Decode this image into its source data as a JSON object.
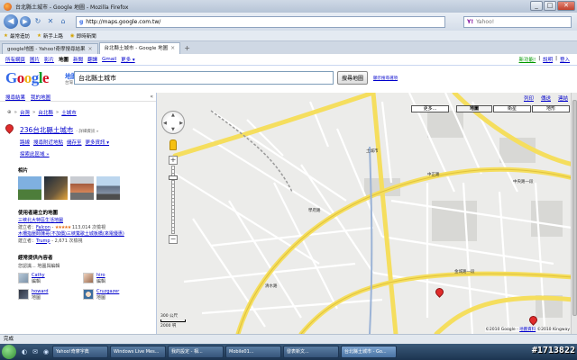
{
  "window": {
    "title": "台北縣土城市 - Google 地圖 - Mozilla Firefox",
    "min": "_",
    "max": "□",
    "close": "✕"
  },
  "nav": {
    "url": "http://maps.google.com.tw/",
    "search_placeholder": "Yahoo!",
    "search_brand": "Y!"
  },
  "bookmarks": [
    "最常造訪",
    "新手上路",
    "即時新聞"
  ],
  "tabs": [
    {
      "label": "google地圖 - Yahoo!奇摩搜尋結果",
      "active": false
    },
    {
      "label": "台北縣土城市 - Google 地圖",
      "active": true
    }
  ],
  "gnav": {
    "links": [
      "所有網頁",
      "圖片",
      "影片",
      "地圖",
      "新聞",
      "翻譯",
      "Gmail",
      "更多 ▾"
    ],
    "current": "地圖",
    "right": [
      "新功能!",
      "說明",
      "登入"
    ],
    "right_sep": "|"
  },
  "header": {
    "logo": {
      "G": "G",
      "o1": "o",
      "o2": "o",
      "g": "g",
      "l": "l",
      "e": "e"
    },
    "logo_sub": "地圖",
    "logo_sub2": "台灣",
    "query": "台北縣土城市",
    "search_button": "搜尋地圖",
    "options_link": "顯示搜尋選項"
  },
  "panel": {
    "subnav": [
      "搜尋結果",
      "我的地圖"
    ],
    "collapse": "«",
    "crumbs": [
      "台灣",
      "台北縣",
      "土城市"
    ],
    "crumb_sep": "»",
    "place_title": "236台北縣土城市",
    "place_sub": "- 詳細資訊 »",
    "actions": [
      "路線",
      "搜尋附近地點",
      "儲存至",
      "更多資訊 ▾"
    ],
    "explore": "探索此區域 »",
    "photos_heading": "相片",
    "maps_heading": "使用者建立的地圖",
    "user_maps": [
      {
        "title": "三峽北大特區生活地圖",
        "meta_prefix": "建立者：",
        "author": "Falcon",
        "sep": " - ",
        "stars": "★★★★★",
        "views": "113,014 次檢視"
      },
      {
        "title": "木柵指壓師陳哥(不加價)三峽鶯歌土城板橋(來電優惠)",
        "meta_prefix": "建立者：",
        "author": "Trump",
        "sep": " - ",
        "stars": "",
        "views": "2,671 次檢視"
      }
    ],
    "contrib_heading": "經常提供內容者",
    "contrib_sub": "您認識... 地圖與編輯",
    "people": [
      {
        "name": "Cathy",
        "role": "編輯"
      },
      {
        "name": "hiro",
        "role": "編輯"
      },
      {
        "name": "howard",
        "role": "地圖"
      },
      {
        "name": "Cruzgazer",
        "role": "地圖"
      }
    ]
  },
  "map": {
    "tools": [
      "列印",
      "傳送",
      "連結"
    ],
    "types": [
      "更多...",
      "地圖",
      "衛星",
      "地形"
    ],
    "active_type": "地圖",
    "pan": {
      "up": "▲",
      "down": "▼",
      "left": "◀",
      "right": "▶"
    },
    "zoom_in": "+",
    "zoom_out": "−",
    "scale": {
      "top": "300 公尺",
      "bottom": "2000 呎"
    },
    "copyright": "©2010 Google -",
    "copyright_link": "地圖資料",
    "copyright_rest": "©2010 Kingway",
    "labels": [
      "土城市",
      "中正路",
      "金城路一段",
      "學府路",
      "清水路",
      "中央路一段"
    ]
  },
  "status": "完成",
  "taskbar": {
    "quicklaunch": [
      "◐",
      "✉",
      "◉"
    ],
    "tasks": [
      {
        "label": "Yahoo!奇摩字典",
        "active": false
      },
      {
        "label": "Windows Live Mes...",
        "active": false
      },
      {
        "label": "我的設定 - 相...",
        "active": false
      },
      {
        "label": "Mobile01...",
        "active": false
      },
      {
        "label": "發表新文...",
        "active": false
      },
      {
        "label": "台北縣土城市 - Go...",
        "active": true
      }
    ]
  },
  "watermark": "#1713822"
}
